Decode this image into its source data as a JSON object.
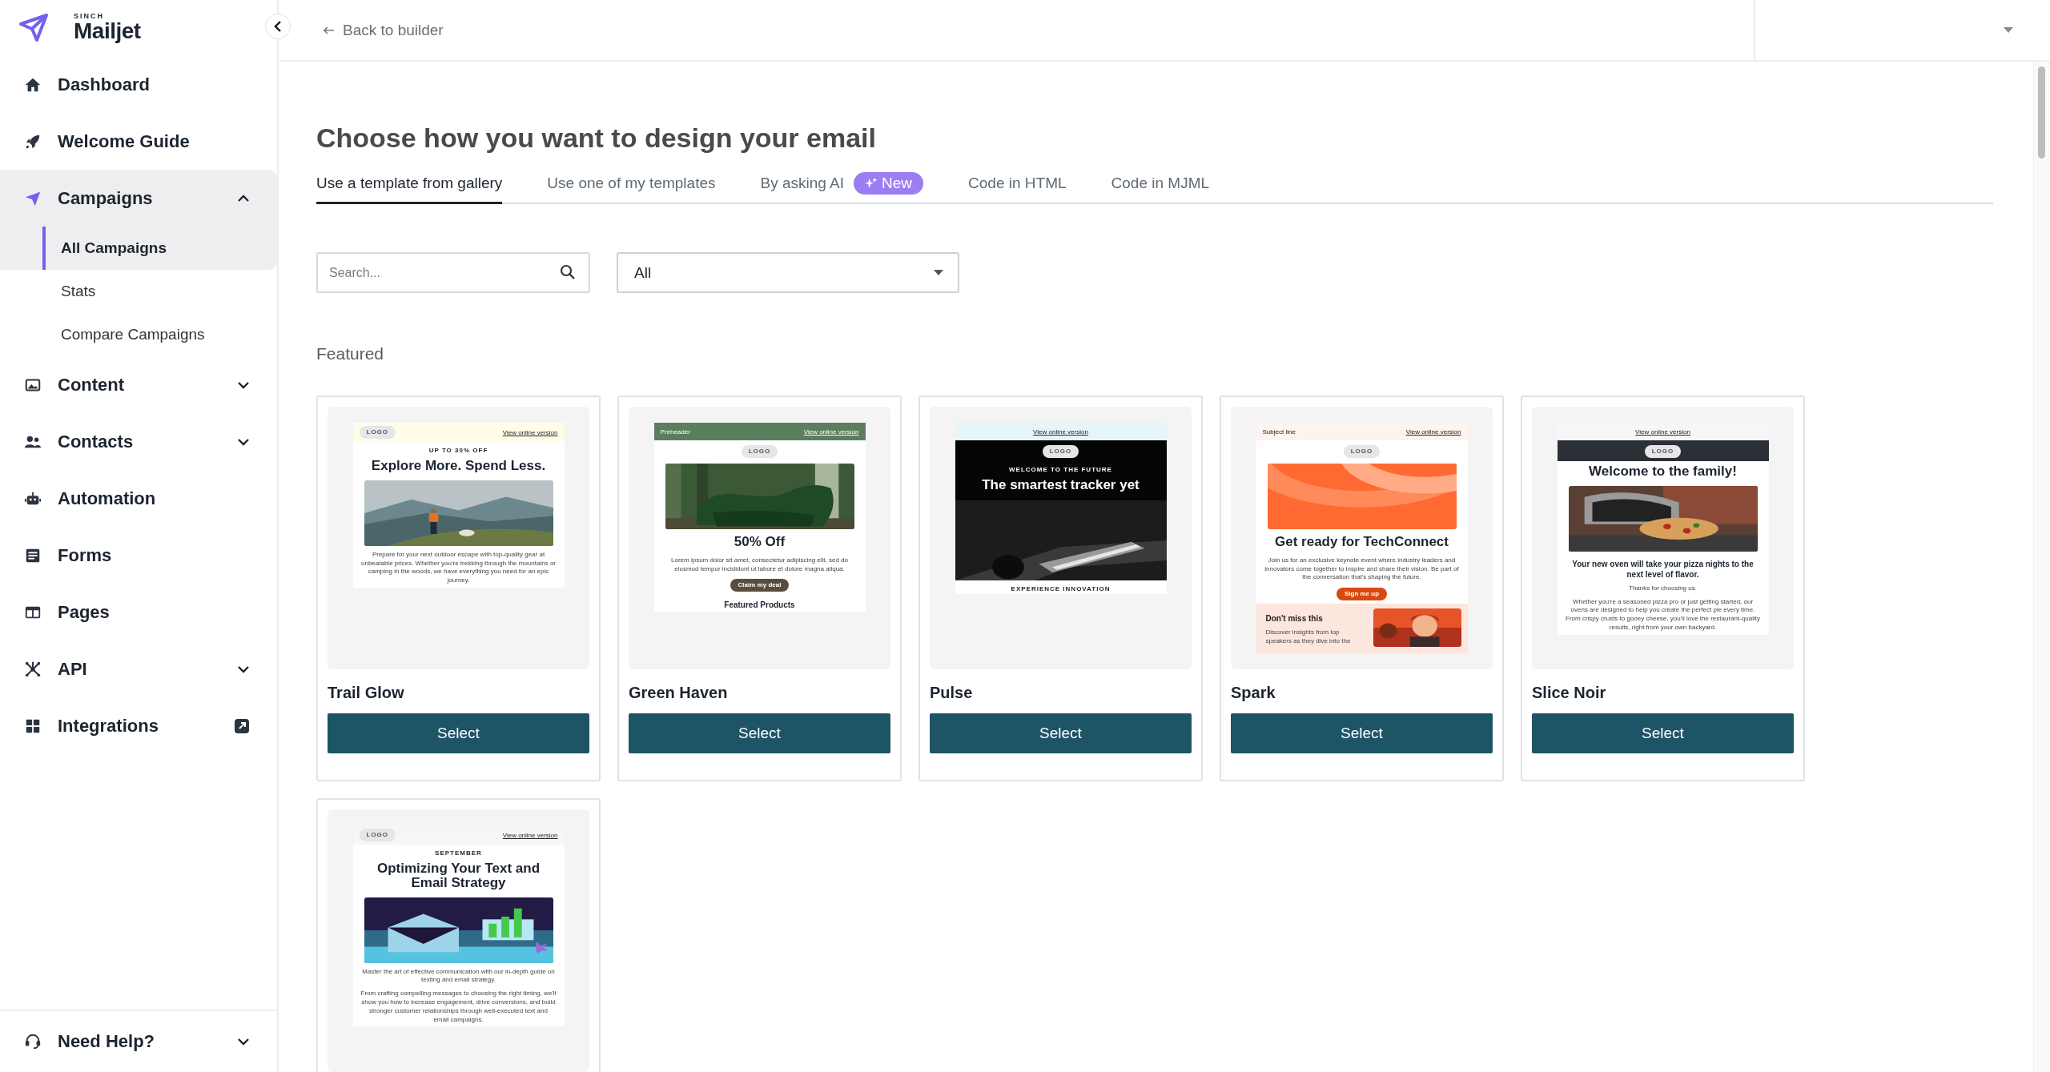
{
  "brand": {
    "eyebrow": "SINCH",
    "name": "Mailjet"
  },
  "sidebar": {
    "items": [
      {
        "label": "Dashboard",
        "selected": false
      },
      {
        "label": "Welcome Guide",
        "selected": false
      },
      {
        "label": "Campaigns",
        "selected": true,
        "expanded": true,
        "children": [
          {
            "label": "All Campaigns",
            "selected": true
          },
          {
            "label": "Stats",
            "selected": false
          },
          {
            "label": "Compare Campaigns",
            "selected": false
          }
        ]
      },
      {
        "label": "Content",
        "selected": false,
        "expanded": false
      },
      {
        "label": "Contacts",
        "selected": false,
        "expanded": false
      },
      {
        "label": "Automation",
        "selected": false
      },
      {
        "label": "Forms",
        "selected": false
      },
      {
        "label": "Pages",
        "selected": false
      },
      {
        "label": "API",
        "selected": false,
        "expanded": false
      },
      {
        "label": "Integrations",
        "selected": false,
        "external": true
      }
    ],
    "help": {
      "label": "Need Help?",
      "expanded": false
    }
  },
  "topbar": {
    "back": "Back to builder"
  },
  "title": "Choose how you want to design your email",
  "tabs": [
    {
      "label": "Use a template from gallery",
      "selected": true
    },
    {
      "label": "Use one of my templates",
      "selected": false
    },
    {
      "label": "By asking AI",
      "selected": false,
      "badge": "New"
    },
    {
      "label": "Code in HTML",
      "selected": false
    },
    {
      "label": "Code in MJML",
      "selected": false
    }
  ],
  "search": {
    "placeholder": "Search..."
  },
  "filter": {
    "value": "All"
  },
  "section": "Featured",
  "templates": [
    {
      "name": "Trail Glow",
      "button": "Select",
      "blocks": [
        {
          "kind": "bar",
          "color": "#fffde8",
          "items": [
            {
              "kind": "logo",
              "text": "LOGO"
            },
            {
              "kind": "link",
              "text": "View online version"
            }
          ]
        },
        {
          "kind": "eyebrow",
          "text": "UP TO 30% OFF"
        },
        {
          "kind": "heading",
          "text": "Explore More. Spend Less."
        },
        {
          "kind": "picture"
        },
        {
          "kind": "text",
          "text": "Prepare for your next outdoor escape with top-quality gear at unbeatable prices. Whether you're trekking through the mountains or camping in the woods, we have everything you need for an epic journey."
        }
      ]
    },
    {
      "name": "Green Haven",
      "button": "Select",
      "blocks": [
        {
          "kind": "bar",
          "color": "#5b7f5c",
          "items": [
            {
              "kind": "plain",
              "text": "Preheader"
            },
            {
              "kind": "link",
              "text": "View online version"
            }
          ]
        },
        {
          "kind": "logo",
          "text": "LOGO"
        },
        {
          "kind": "picture"
        },
        {
          "kind": "heading",
          "text": "50% Off"
        },
        {
          "kind": "text",
          "text": "Lorem ipsum dolor sit amet, consectetur adipiscing elit, sed do eiusmod tempor incididunt ut labore et dolore magna aliqua."
        },
        {
          "kind": "button",
          "text": "Claim my deal",
          "color": "#5b4d3e"
        },
        {
          "kind": "subheading",
          "text": "Featured Products"
        }
      ]
    },
    {
      "name": "Pulse",
      "button": "Select",
      "blocks": [
        {
          "kind": "bar",
          "color": "#e6f4fb",
          "items": [
            {
              "kind": "link",
              "text": "View online version"
            }
          ]
        },
        {
          "kind": "section",
          "color": "#050505",
          "blocks": [
            {
              "kind": "logo",
              "text": "LOGO"
            },
            {
              "kind": "eyebrow",
              "text": "WELCOME TO THE FUTURE"
            },
            {
              "kind": "heading",
              "text": "The smartest tracker yet"
            },
            {
              "kind": "picture"
            }
          ]
        },
        {
          "kind": "eyebrow",
          "text": "EXPERIENCE INNOVATION"
        }
      ]
    },
    {
      "name": "Spark",
      "button": "Select",
      "blocks": [
        {
          "kind": "bar",
          "color": "#fdf3ef",
          "items": [
            {
              "kind": "plain",
              "text": "Subject line"
            },
            {
              "kind": "link",
              "text": "View online version"
            }
          ]
        },
        {
          "kind": "logo",
          "text": "LOGO"
        },
        {
          "kind": "picture"
        },
        {
          "kind": "heading",
          "text": "Get ready for TechConnect"
        },
        {
          "kind": "text",
          "text": "Join us for an exclusive keynote event where industry leaders and innovators come together to inspire and share their vision. Be part of the conversation that's shaping the future."
        },
        {
          "kind": "button",
          "text": "Sign me up",
          "color": "#d9480f"
        },
        {
          "kind": "split",
          "color": "#fde6de",
          "blocks": [
            {
              "kind": "column",
              "blocks": [
                {
                  "kind": "subheading",
                  "text": "Don't miss this"
                },
                {
                  "kind": "text",
                  "text": "Discover insights from top speakers as they dive into the"
                }
              ]
            },
            {
              "kind": "picture"
            }
          ]
        }
      ]
    },
    {
      "name": "Slice Noir",
      "button": "Select",
      "blocks": [
        {
          "kind": "bar",
          "color": "#f6f6f6",
          "items": [
            {
              "kind": "link",
              "text": "View online version"
            }
          ]
        },
        {
          "kind": "section",
          "color": "#2b3036",
          "blocks": [
            {
              "kind": "logo",
              "text": "LOGO"
            }
          ]
        },
        {
          "kind": "heading",
          "text": "Welcome to the family!"
        },
        {
          "kind": "picture"
        },
        {
          "kind": "subheading",
          "text": "Your new oven will take your pizza nights to the next level of flavor."
        },
        {
          "kind": "text",
          "text": "Thanks for choosing us."
        },
        {
          "kind": "text",
          "text": "Whether you're a seasoned pizza pro or just getting started, our ovens are designed to help you create the perfect pie every time. From crispy crusts to gooey cheese, you'll love the restaurant-quality results, right from your own backyard."
        }
      ]
    },
    {
      "blocks": [
        {
          "kind": "bar",
          "color": "#f6f6f6",
          "items": [
            {
              "kind": "logo",
              "text": "LOGO"
            },
            {
              "kind": "link",
              "text": "View online version"
            }
          ]
        },
        {
          "kind": "eyebrow",
          "text": "SEPTEMBER"
        },
        {
          "kind": "heading",
          "text": "Optimizing Your Text and Email Strategy"
        },
        {
          "kind": "picture"
        },
        {
          "kind": "text",
          "text": "Master the art of effective communication with our in-depth guide on texting and email strategy."
        },
        {
          "kind": "text",
          "text": "From crafting compelling messages to choosing the right timing, we'll show you how to increase engagement, drive conversions, and build stronger customer relationships through well-executed text and email campaigns."
        }
      ]
    }
  ]
}
